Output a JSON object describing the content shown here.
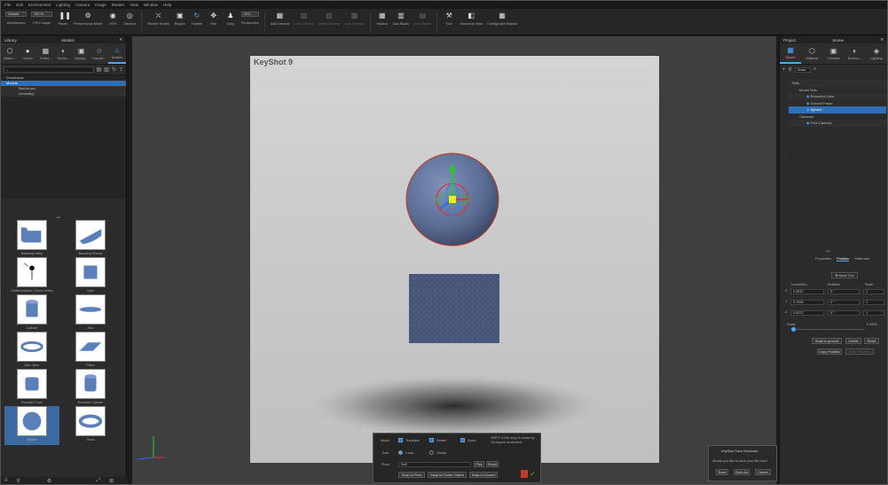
{
  "menu": [
    "File",
    "Edit",
    "Environment",
    "Lighting",
    "Camera",
    "Image",
    "Render",
    "View",
    "Window",
    "Help"
  ],
  "ribbon": {
    "workspace_value": "Default",
    "cpu_value": "100 %",
    "fps_value": "40.0",
    "items": [
      {
        "label": "Workspaces",
        "icon": "workspaces-icon",
        "glyph": "▤",
        "dim": false
      },
      {
        "label": "CPU Usage",
        "icon": "cpu-icon",
        "glyph": "▥",
        "dim": false
      },
      {
        "label": "Pause",
        "icon": "pause-icon",
        "glyph": "❚❚",
        "dim": false
      },
      {
        "label": "Performance Mode",
        "icon": "performance-icon",
        "glyph": "⚙",
        "dim": false
      },
      {
        "label": "GPU",
        "icon": "gpu-icon",
        "glyph": "◉",
        "dim": false
      },
      {
        "label": "Denoise",
        "icon": "denoise-icon",
        "glyph": "◎",
        "dim": false
      },
      {
        "label": "Render Nodes",
        "icon": "render-nodes-icon",
        "glyph": "⛌",
        "dim": false
      },
      {
        "label": "Region",
        "icon": "region-icon",
        "glyph": "▣",
        "dim": false
      },
      {
        "label": "Tumble",
        "icon": "tumble-icon",
        "glyph": "↻",
        "dim": false,
        "sel": true
      },
      {
        "label": "Pan",
        "icon": "pan-icon",
        "glyph": "✥",
        "dim": false
      },
      {
        "label": "Dolly",
        "icon": "dolly-icon",
        "glyph": "♟",
        "dim": false
      },
      {
        "label": "Perspective",
        "icon": "perspective-icon",
        "glyph": "",
        "dim": false
      },
      {
        "label": "Add Camera",
        "icon": "add-camera-icon",
        "glyph": "▦",
        "dim": false
      },
      {
        "label": "Lock Camera",
        "icon": "lock-camera-icon",
        "glyph": "▧",
        "dim": true
      },
      {
        "label": "Reset Camera",
        "icon": "reset-camera-icon",
        "glyph": "▨",
        "dim": true
      },
      {
        "label": "Lock Camera",
        "icon": "lock-camera-2-icon",
        "glyph": "▩",
        "dim": true
      },
      {
        "label": "Studios",
        "icon": "studios-icon",
        "glyph": "▦",
        "dim": false
      },
      {
        "label": "Add Studio",
        "icon": "add-studio-icon",
        "glyph": "▥",
        "dim": false
      },
      {
        "label": "Lock Studio",
        "icon": "lock-studio-icon",
        "glyph": "▤",
        "dim": true
      },
      {
        "label": "Tool",
        "icon": "tool-icon",
        "glyph": "⚒",
        "dim": false
      },
      {
        "label": "Geometry View",
        "icon": "geometry-view-icon",
        "glyph": "◧",
        "dim": false
      },
      {
        "label": "Configurator Wizard",
        "icon": "configurator-icon",
        "glyph": "▦",
        "dim": false
      }
    ]
  },
  "left_panel": {
    "title_left": "Library",
    "title_center": "Models",
    "tabs": [
      {
        "label": "Materi...",
        "icon": "materials-icon",
        "glyph": "⬡"
      },
      {
        "label": "Colors",
        "icon": "colors-icon",
        "glyph": "●"
      },
      {
        "label": "Textur...",
        "icon": "textures-icon",
        "glyph": "▦"
      },
      {
        "label": "Enviro...",
        "icon": "environments-icon",
        "glyph": "◐"
      },
      {
        "label": "Backpl...",
        "icon": "backplates-icon",
        "glyph": "▣"
      },
      {
        "label": "Favorit...",
        "icon": "favorites-icon",
        "glyph": "☆"
      },
      {
        "label": "Models",
        "icon": "models-icon",
        "glyph": "⌂",
        "sel": true
      }
    ],
    "tree": [
      {
        "label": "Downloads",
        "sel": false,
        "sub": false
      },
      {
        "label": "Models",
        "sel": true,
        "sub": false
      },
      {
        "label": "Backdrops",
        "sel": false,
        "sub": true
      },
      {
        "label": "Geometry",
        "sel": false,
        "sub": true
      }
    ],
    "models": [
      {
        "label": "Backdrop Hshp",
        "shape": "backdrop"
      },
      {
        "label": "Backdrop Round",
        "shape": "backdrop-round"
      },
      {
        "label": "Coffeerenderer / Zoom-Vertex",
        "shape": "point"
      },
      {
        "label": "Cube",
        "shape": "cube"
      },
      {
        "label": "Cylinder",
        "shape": "cylinder"
      },
      {
        "label": "Disc",
        "shape": "disc"
      },
      {
        "label": "Disc Open",
        "shape": "ring"
      },
      {
        "label": "Plane",
        "shape": "plane"
      },
      {
        "label": "Rounded Cube",
        "shape": "rcube"
      },
      {
        "label": "Rounded Cylinder",
        "shape": "rcyl"
      },
      {
        "label": "Sphere",
        "shape": "sphere",
        "sel": true
      },
      {
        "label": "Torus",
        "shape": "torus"
      }
    ]
  },
  "viewport": {
    "label": "KeyShot 9"
  },
  "right_panel": {
    "title_left": "Project",
    "title_center": "Scene",
    "tabs": [
      {
        "label": "Scene",
        "icon": "scene-icon",
        "glyph": "▦",
        "sel": true
      },
      {
        "label": "Material",
        "icon": "material-icon",
        "glyph": "⬡"
      },
      {
        "label": "Camera",
        "icon": "camera-icon",
        "glyph": "▣"
      },
      {
        "label": "Environ...",
        "icon": "environment-icon",
        "glyph": "◐"
      },
      {
        "label": "Lighting",
        "icon": "lighting-icon",
        "glyph": "◈"
      }
    ],
    "filter_value": "Show",
    "tree": [
      {
        "label": "Sets",
        "indent": 0,
        "sel": false
      },
      {
        "label": "Model Sets",
        "indent": 1,
        "sel": false
      },
      {
        "label": "Rounded Cube",
        "indent": 2,
        "sel": false
      },
      {
        "label": "Ground Plane",
        "indent": 2,
        "sel": false
      },
      {
        "label": "Sphere",
        "indent": 2,
        "sel": true
      },
      {
        "label": "Cameras",
        "indent": 1,
        "sel": false
      },
      {
        "label": "Free Camera",
        "indent": 2,
        "sel": false
      }
    ],
    "subtabs": [
      "Properties",
      "Position",
      "Materials"
    ],
    "move_tool": "Move Tool",
    "col_headers": [
      "Translation",
      "Rotation",
      "Scale"
    ],
    "rows": [
      {
        "axis": "X",
        "t": "0.0537",
        "r": "0 °",
        "s": "1"
      },
      {
        "axis": "Y",
        "t": "0.7995",
        "r": "0 °",
        "s": "1"
      },
      {
        "axis": "Z",
        "t": "0.0072",
        "r": "0 °",
        "s": "1"
      }
    ],
    "scale_label": "Scale",
    "scale_value": "0.9995",
    "buttons": [
      "Snap to ground",
      "Center",
      "Reset"
    ],
    "copy_btn": "Copy Position",
    "paste_btn": "Paste Position"
  },
  "hud": {
    "mode_label": "Mode:",
    "mode_opts": [
      "Translate",
      "Rotate",
      "Scale"
    ],
    "axis_label": "Axis:",
    "axis_opts": [
      "Local",
      "Global"
    ],
    "pivot_label": "Pivot:",
    "pivot_value": "Self",
    "pick_btn": "Pick",
    "reset_btn": "Reset",
    "hint": "SHIFT+LMB drag to rotate by 15 degree increment",
    "snap_btns": [
      "Snap to Pivot",
      "Snap to Center Object",
      "Snap to Ground"
    ]
  },
  "save_reminder": {
    "title": "KeyShot Save Reminder",
    "message": "Would you like to save your file now?",
    "buttons": [
      "Save",
      "Save As",
      "Cancel"
    ]
  }
}
